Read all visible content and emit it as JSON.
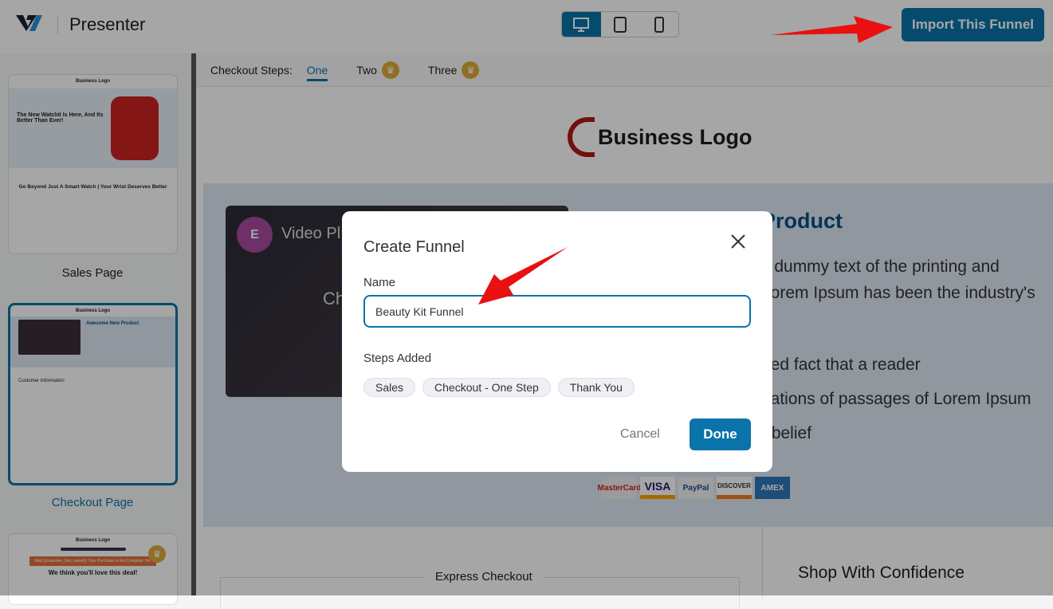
{
  "header": {
    "title": "Presenter",
    "import_label": "Import This Funnel",
    "devices": [
      "desktop-icon",
      "tablet-icon",
      "mobile-icon"
    ]
  },
  "sidebar": {
    "items": [
      {
        "label": "Sales Page",
        "thumb_headline": "The New Watchit Is Here, And Its Better Than Ever!",
        "thumb_sub": "Go Beyond Just A Smart Watch | Your Wrist Deserves Better",
        "thumb_logo": "Business Logo"
      },
      {
        "label": "Checkout Page",
        "thumb_title": "Awesome New Product",
        "thumb_section": "Customer Information",
        "thumb_logo": "Business Logo"
      },
      {
        "label": "",
        "thumb_banner": "Wait {{customer_first_name}}! Your Purchase is Not Complete Yet.",
        "thumb_headline": "We think you'll love this deal!",
        "thumb_logo": "Business Logo"
      }
    ]
  },
  "checkout_steps": {
    "label": "Checkout Steps:",
    "options": [
      {
        "label": "One",
        "active": true
      },
      {
        "label": "Two",
        "pro": true
      },
      {
        "label": "Three",
        "pro": true
      }
    ]
  },
  "preview": {
    "logo": "Business Logo",
    "video_title": "Video Pl",
    "video_center": "Ch",
    "product_title": "Product",
    "lines": [
      "y dummy text of the printing and",
      "Lorem Ipsum has been the industry's",
      "hed fact that a reader",
      "riations of passages of Lorem Ipsum",
      "r belief"
    ],
    "cards": [
      "MasterCard",
      "VISA",
      "PayPal",
      "DISCOVER",
      "AMEX"
    ],
    "express_checkout": "Express Checkout",
    "shop_with_confidence": "Shop With Confidence"
  },
  "modal": {
    "title": "Create Funnel",
    "name_label": "Name",
    "name_value": "Beauty Kit Funnel",
    "steps_label": "Steps Added",
    "steps": [
      "Sales",
      "Checkout - One Step",
      "Thank You"
    ],
    "cancel": "Cancel",
    "done": "Done"
  },
  "colors": {
    "accent": "#0a73aa",
    "crown": "#e0a93a",
    "arrow": "#e81010"
  }
}
